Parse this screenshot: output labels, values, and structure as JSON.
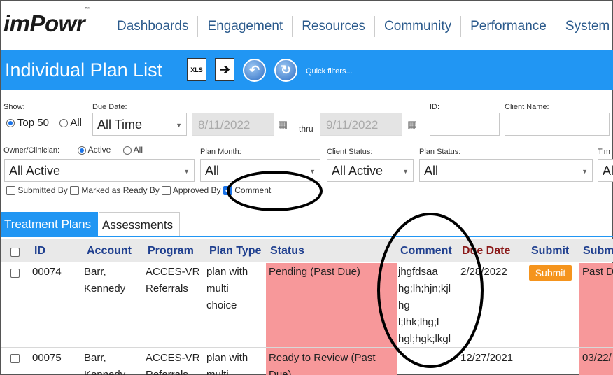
{
  "app": {
    "logo": "imPowr",
    "logo_mark": "™"
  },
  "nav": [
    "Dashboards",
    "Engagement",
    "Resources",
    "Community",
    "Performance",
    "System"
  ],
  "header": {
    "title": "Individual Plan List",
    "xls_label": "XLS",
    "quick_filters": "Quick filters..."
  },
  "filters": {
    "show_label": "Show:",
    "show_top50": "Top 50",
    "show_all": "All",
    "due_date_label": "Due Date:",
    "due_date_value": "All Time",
    "date_from": "8/11/2022",
    "thru": "thru",
    "date_to": "9/11/2022",
    "id_label": "ID:",
    "client_name_label": "Client Name:",
    "owner_label": "Owner/Clinician:",
    "owner_active": "Active",
    "owner_all": "All",
    "owner_value": "All Active",
    "plan_month_label": "Plan Month:",
    "plan_month_value": "All",
    "client_status_label": "Client Status:",
    "client_status_value": "All Active",
    "plan_status_label": "Plan Status:",
    "plan_status_value": "All",
    "time_label": "Tim",
    "time_value": "Al",
    "cb_submitted": "Submitted By",
    "cb_marked": "Marked as Ready By",
    "cb_approved": "Approved By",
    "cb_comment": "Comment"
  },
  "tabs": [
    "Treatment Plans",
    "Assessments"
  ],
  "table": {
    "columns": [
      "ID",
      "Account",
      "Program",
      "Plan Type",
      "Status",
      "Comment",
      "Due Date",
      "Submit",
      "Subm"
    ],
    "rows": [
      {
        "id": "00074",
        "account": [
          "Barr,",
          "Kennedy"
        ],
        "program": [
          "ACCES-VR",
          "Referrals"
        ],
        "plan_type": [
          "plan with",
          "multi",
          "choice"
        ],
        "status": "Pending (Past Due)",
        "comment": [
          "jhgfdsaa",
          "hg;lh;hjn;kjl",
          "hg",
          "l;lhk;lhg;l",
          "hgl;hgk;lkgl"
        ],
        "due_date": "2/28/2022",
        "submit": "Submit",
        "subm": "Past D"
      },
      {
        "id": "00075",
        "account": [
          "Barr,",
          "Kennedy"
        ],
        "program": [
          "ACCES-VR",
          "Referrals"
        ],
        "plan_type": [
          "plan with",
          "multi"
        ],
        "status": [
          "Ready to Review (Past",
          "Due)"
        ],
        "comment": [],
        "due_date": "12/27/2021",
        "submit": "",
        "subm": "03/22/"
      }
    ]
  },
  "colors": {
    "accent": "#2196f3",
    "status_pink": "#f7989a",
    "submit_orange": "#f5941d",
    "header_blue": "#1f3f8f",
    "due_red": "#8b1a1a"
  }
}
